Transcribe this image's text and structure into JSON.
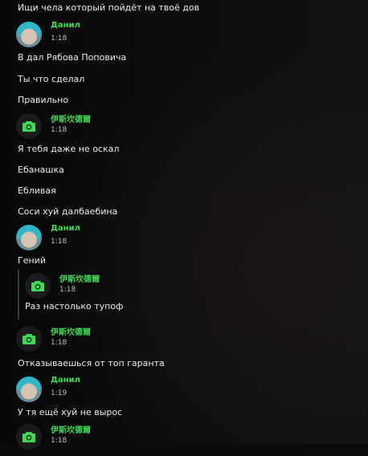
{
  "items": [
    {
      "kind": "text",
      "text": "Ищи чела который пойдёт на твоё дов"
    },
    {
      "kind": "author",
      "name": "Данил",
      "time": "1:18",
      "avatar": "photo-avatar"
    },
    {
      "kind": "text",
      "text": "В дал Рябова Поповича"
    },
    {
      "kind": "text",
      "text": "Ты что сделал"
    },
    {
      "kind": "text",
      "text": "Правильно"
    },
    {
      "kind": "author",
      "name": "伊斯坎德爾",
      "time": "1:18",
      "avatar": "camera-icon"
    },
    {
      "kind": "text",
      "text": "Я тебя даже не оскал"
    },
    {
      "kind": "text",
      "text": "Ебанашка"
    },
    {
      "kind": "text",
      "text": "Ебливая"
    },
    {
      "kind": "text",
      "text": "Соси хуй далбаебина"
    },
    {
      "kind": "author",
      "name": "Данил",
      "time": "1:18",
      "avatar": "photo-avatar"
    },
    {
      "kind": "text",
      "text": "Гений"
    },
    {
      "kind": "quote",
      "name": "伊斯坎德爾",
      "time": "1:18",
      "text": "Раз настолько тупоф",
      "avatar": "camera-icon"
    },
    {
      "kind": "author",
      "name": "伊斯坎德爾",
      "time": "1:18",
      "avatar": "camera-icon"
    },
    {
      "kind": "text",
      "text": "Отказываешься от топ гаранта"
    },
    {
      "kind": "author",
      "name": "Данил",
      "time": "1:19",
      "avatar": "photo-avatar"
    },
    {
      "kind": "text",
      "text": "У тя ещё хуй не вырос"
    },
    {
      "kind": "author",
      "name": "伊斯坎德爾",
      "time": "1:18",
      "avatar": "camera-icon"
    }
  ],
  "colors": {
    "author": "#3fd957",
    "text": "#ececec",
    "time": "#bdbdbd",
    "background": "#0b0b0b"
  }
}
